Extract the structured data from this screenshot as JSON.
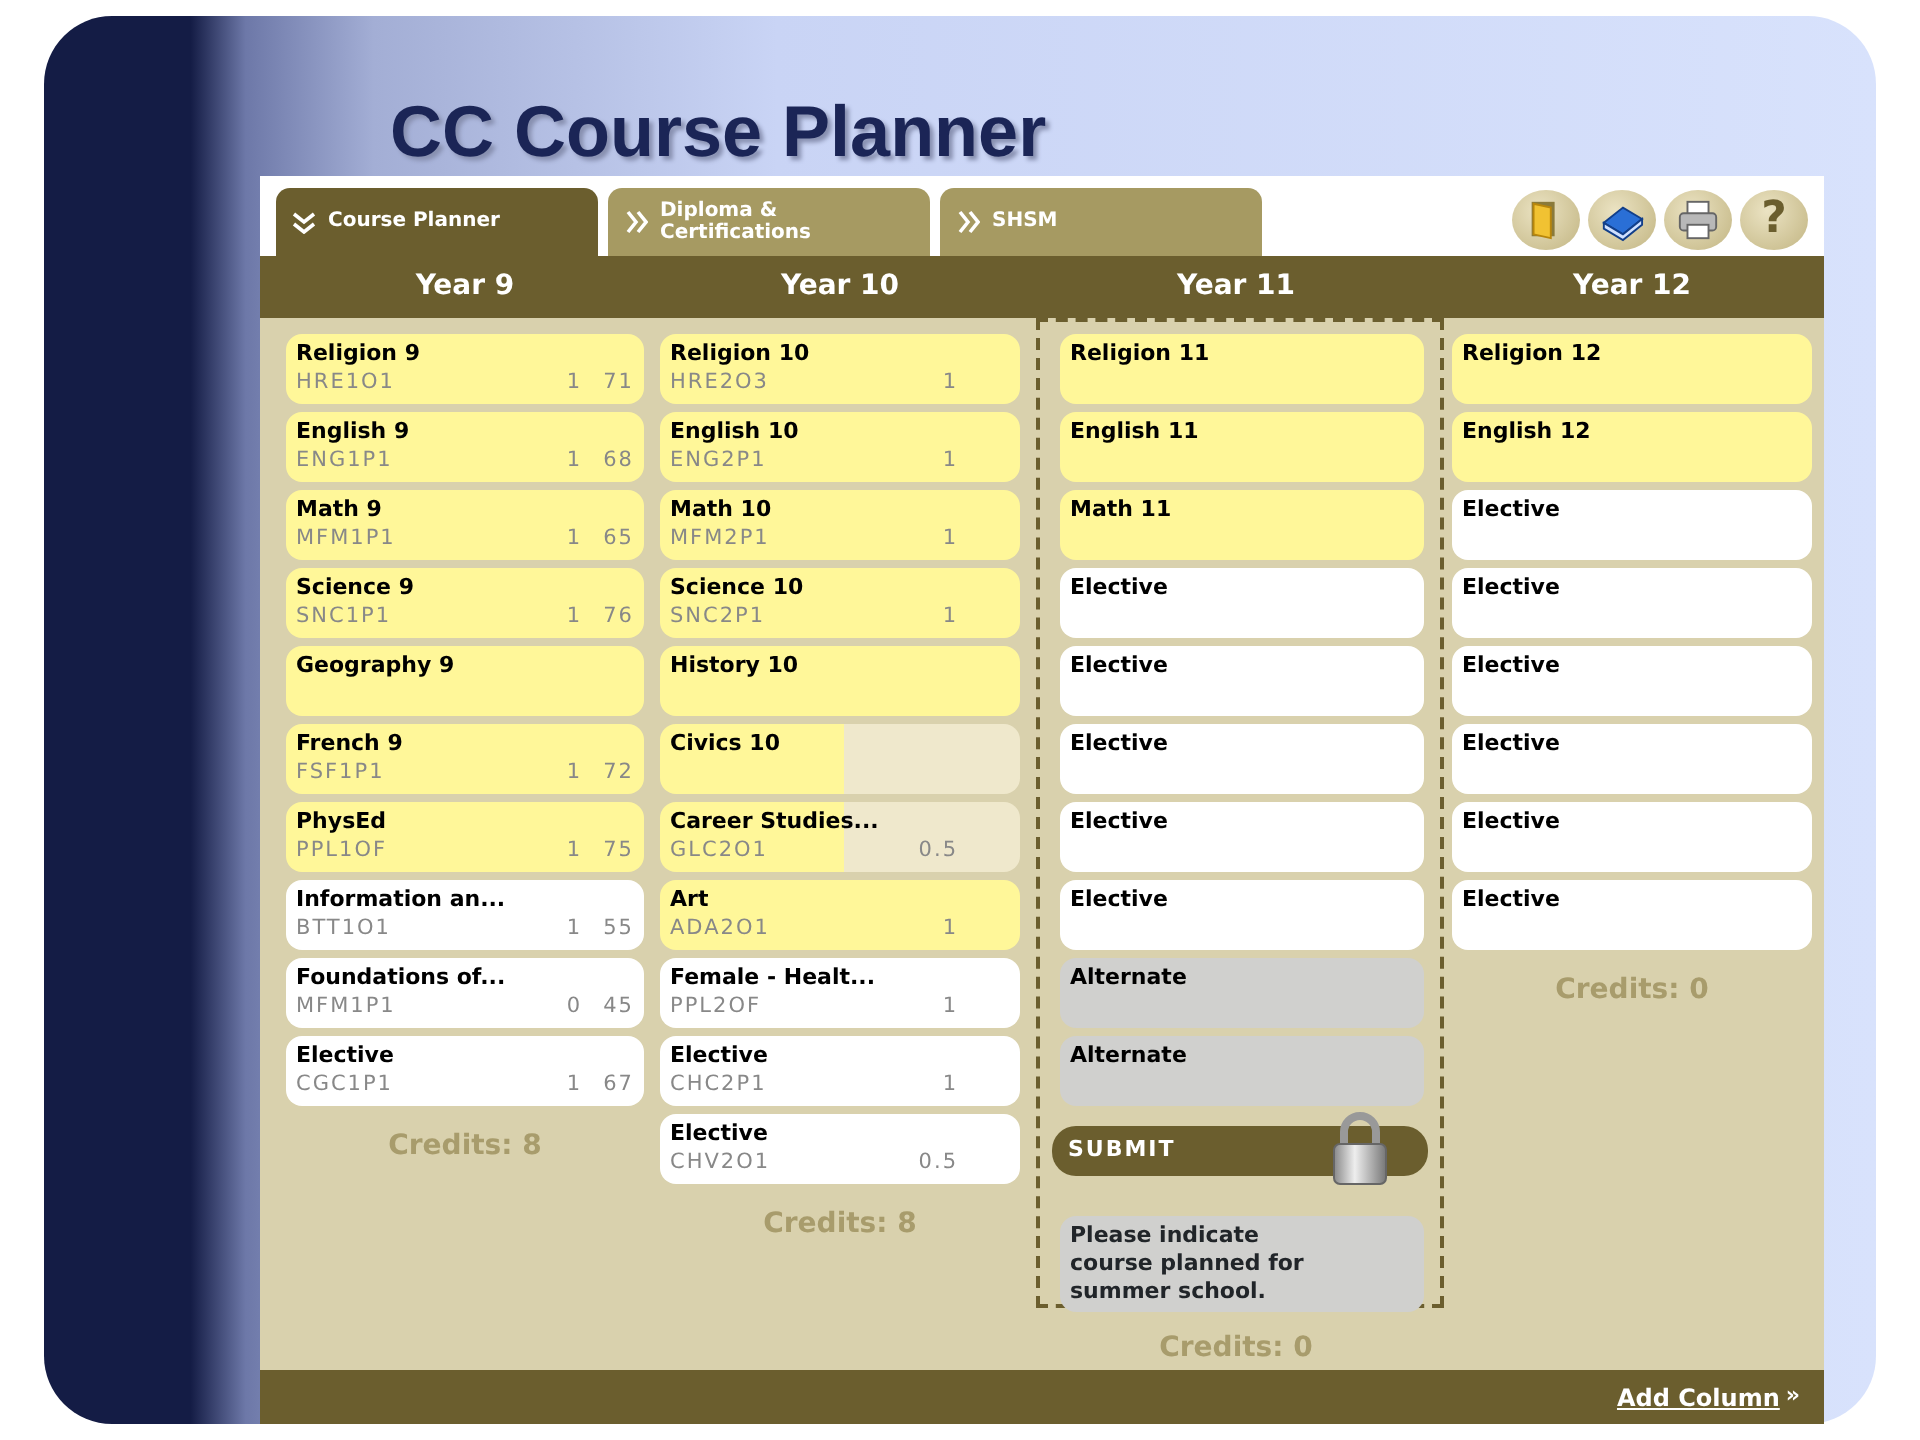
{
  "slide": {
    "title": "CC Course Planner"
  },
  "tabs": [
    {
      "label": "Course Planner",
      "selected": true
    },
    {
      "label": "Diploma & Certifications",
      "selected": false
    },
    {
      "label": "SHSM",
      "selected": false
    }
  ],
  "toolbar": {
    "help_label": "?"
  },
  "years": [
    {
      "heading": "Year 9",
      "selected": false,
      "credits": "Credits: 8",
      "courses": [
        {
          "name": "Religion 9",
          "code": "HRE1O1",
          "credit": "1",
          "mark": "71",
          "kind": "required"
        },
        {
          "name": "English 9",
          "code": "ENG1P1",
          "credit": "1",
          "mark": "68",
          "kind": "required"
        },
        {
          "name": "Math 9",
          "code": "MFM1P1",
          "credit": "1",
          "mark": "65",
          "kind": "required"
        },
        {
          "name": "Science 9",
          "code": "SNC1P1",
          "credit": "1",
          "mark": "76",
          "kind": "required"
        },
        {
          "name": "Geography 9",
          "kind": "required"
        },
        {
          "name": "French 9",
          "code": "FSF1P1",
          "credit": "1",
          "mark": "72",
          "kind": "required"
        },
        {
          "name": "PhysEd",
          "code": "PPL1OF",
          "credit": "1",
          "mark": "75",
          "kind": "required"
        },
        {
          "name": "Information an...",
          "code": "BTT1O1",
          "credit": "1",
          "mark": "55",
          "kind": "elective"
        },
        {
          "name": "Foundations of...",
          "code": "MFM1P1",
          "credit": "0",
          "mark": "45",
          "kind": "elective"
        },
        {
          "name": "Elective",
          "code": "CGC1P1",
          "credit": "1",
          "mark": "67",
          "kind": "elective"
        }
      ]
    },
    {
      "heading": "Year 10",
      "selected": false,
      "credits": "Credits: 8",
      "courses": [
        {
          "name": "Religion 10",
          "code": "HRE2O3",
          "credit": "1",
          "kind": "required"
        },
        {
          "name": "English 10",
          "code": "ENG2P1",
          "credit": "1",
          "kind": "required"
        },
        {
          "name": "Math 10",
          "code": "MFM2P1",
          "credit": "1",
          "kind": "required"
        },
        {
          "name": "Science 10",
          "code": "SNC2P1",
          "credit": "1",
          "kind": "required"
        },
        {
          "name": "History 10",
          "kind": "required"
        },
        {
          "name": "Civics 10",
          "kind": "half"
        },
        {
          "name": "Career Studies...",
          "code": "GLC2O1",
          "credit": "0.5",
          "kind": "half"
        },
        {
          "name": "Art",
          "code": "ADA2O1",
          "credit": "1",
          "kind": "required"
        },
        {
          "name": "Female - Healt...",
          "code": "PPL2OF",
          "credit": "1",
          "kind": "elective"
        },
        {
          "name": "Elective",
          "code": "CHC2P1",
          "credit": "1",
          "kind": "elective"
        },
        {
          "name": "Elective",
          "code": "CHV2O1",
          "credit": "0.5",
          "kind": "elective"
        }
      ]
    },
    {
      "heading": "Year 11",
      "selected": true,
      "credits": "Credits: 0",
      "courses": [
        {
          "name": "Religion 11",
          "kind": "required"
        },
        {
          "name": "English 11",
          "kind": "required"
        },
        {
          "name": "Math 11",
          "kind": "required"
        },
        {
          "name": "Elective",
          "kind": "elective"
        },
        {
          "name": "Elective",
          "kind": "elective"
        },
        {
          "name": "Elective",
          "kind": "elective"
        },
        {
          "name": "Elective",
          "kind": "elective"
        },
        {
          "name": "Elective",
          "kind": "elective"
        },
        {
          "name": "Alternate",
          "kind": "alternate"
        },
        {
          "name": "Alternate",
          "kind": "alternate"
        }
      ],
      "submit": {
        "label": "SUBMIT",
        "locked": true
      },
      "note": "Please indicate course planned for summer school."
    },
    {
      "heading": "Year 12",
      "selected": false,
      "credits": "Credits: 0",
      "courses": [
        {
          "name": "Religion 12",
          "kind": "required"
        },
        {
          "name": "English 12",
          "kind": "required"
        },
        {
          "name": "Elective",
          "kind": "elective"
        },
        {
          "name": "Elective",
          "kind": "elective"
        },
        {
          "name": "Elective",
          "kind": "elective"
        },
        {
          "name": "Elective",
          "kind": "elective"
        },
        {
          "name": "Elective",
          "kind": "elective"
        },
        {
          "name": "Elective",
          "kind": "elective"
        }
      ]
    }
  ],
  "footer": {
    "link": "Add Column",
    "arrow": "»"
  }
}
